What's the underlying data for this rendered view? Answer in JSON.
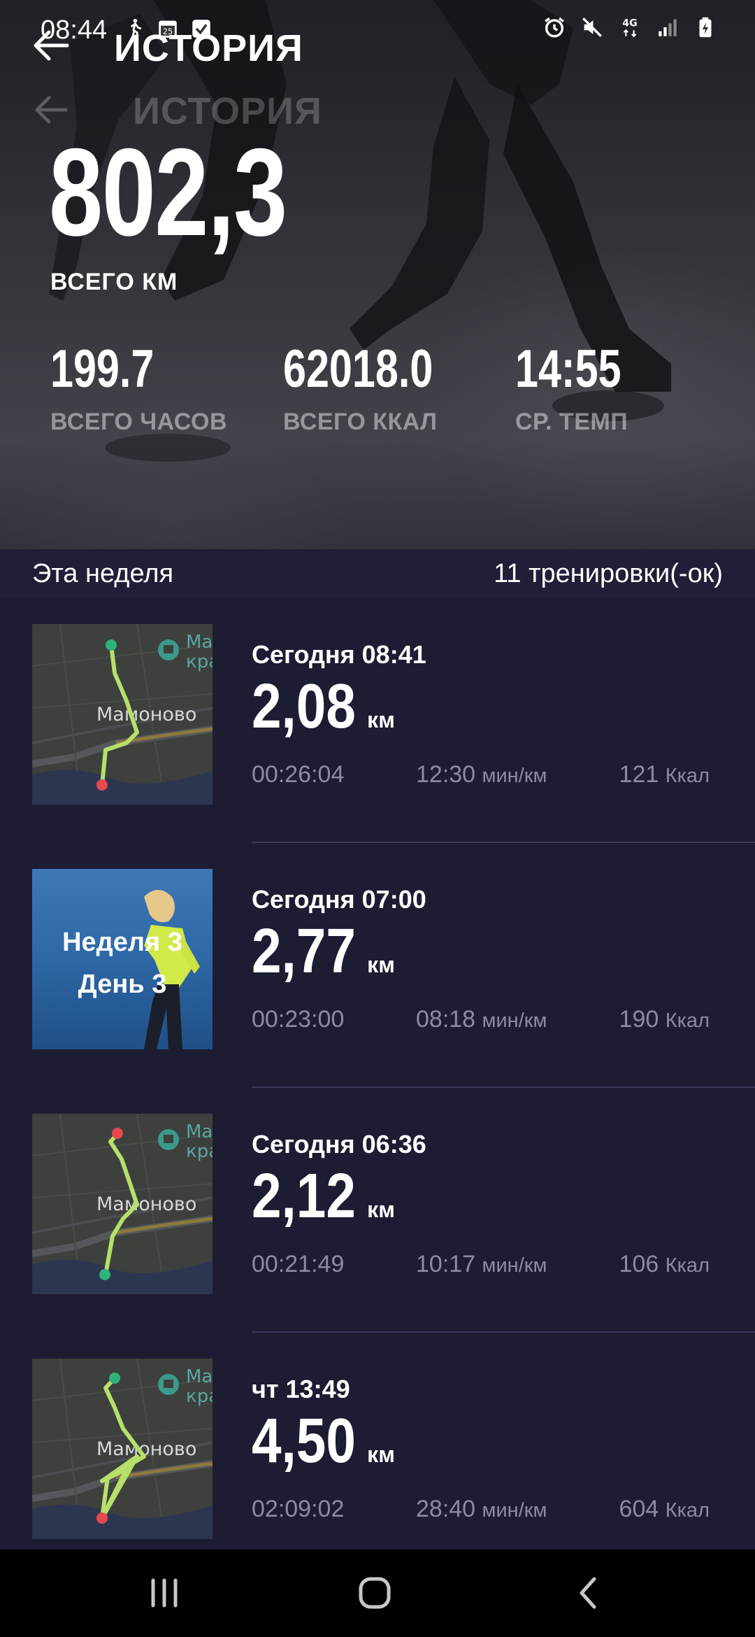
{
  "status_bar": {
    "time": "08:44",
    "left_icons": [
      "walk-icon",
      "calendar-25-icon",
      "check-square-icon"
    ],
    "right_icons": [
      "alarm-icon",
      "mute-icon",
      "network-4g-icon",
      "signal-icon",
      "battery-charging-icon"
    ],
    "network_label": "4G"
  },
  "header": {
    "title": "ИСТОРИЯ",
    "ghost_title": "ИСТОРИЯ"
  },
  "summary": {
    "total_km": "802,3",
    "total_km_label": "ВСЕГО КМ",
    "stats": [
      {
        "value": "199.7",
        "label": "ВСЕГО ЧАСОВ"
      },
      {
        "value": "62018.0",
        "label": "ВСЕГО ККАЛ"
      },
      {
        "value": "14:55",
        "label": "СР. ТЕМП"
      }
    ]
  },
  "week": {
    "label": "Эта неделя",
    "count": "11 тренировки(-ок)"
  },
  "map_label": "Мамоново",
  "workouts": [
    {
      "date": "Сегодня 08:41",
      "distance": "2,08",
      "unit": "км",
      "duration": "00:26:04",
      "pace": "12:30",
      "pace_unit": "мин/км",
      "kcal": "121",
      "kcal_unit": "Ккал",
      "thumb": "map"
    },
    {
      "date": "Сегодня 07:00",
      "distance": "2,77",
      "unit": "км",
      "duration": "00:23:00",
      "pace": "08:18",
      "pace_unit": "мин/км",
      "kcal": "190",
      "kcal_unit": "Ккал",
      "thumb": "plan",
      "plan_week": "Неделя 3",
      "plan_day": "День 3"
    },
    {
      "date": "Сегодня 06:36",
      "distance": "2,12",
      "unit": "км",
      "duration": "00:21:49",
      "pace": "10:17",
      "pace_unit": "мин/км",
      "kcal": "106",
      "kcal_unit": "Ккал",
      "thumb": "map"
    },
    {
      "date": "чт 13:49",
      "distance": "4,50",
      "unit": "км",
      "duration": "02:09:02",
      "pace": "28:40",
      "pace_unit": "мин/км",
      "kcal": "604",
      "kcal_unit": "Ккал",
      "thumb": "map"
    }
  ],
  "colors": {
    "background": "#1c1c33",
    "route": "#b6e06a",
    "start_dot": "#2fb37a",
    "end_dot": "#e8494f",
    "muted_text": "#8b8ba6"
  },
  "system_nav": [
    "recents-icon",
    "home-icon",
    "back-icon"
  ]
}
